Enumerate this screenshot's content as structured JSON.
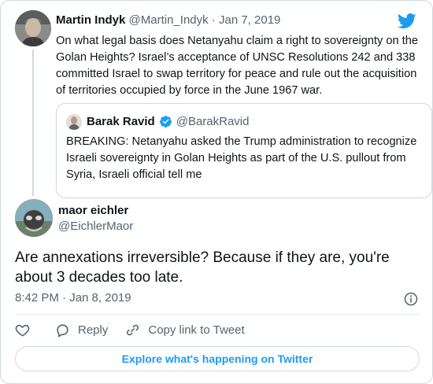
{
  "parent_tweet": {
    "author_name": "Martin Indyk",
    "handle": "@Martin_Indyk",
    "separator": "·",
    "date": "Jan 7, 2019",
    "text": "On what legal basis does Netanyahu claim a right to sovereignty on the Golan Heights? Israel’s acceptance of UNSC Resolutions 242 and 338 committed Israel to swap territory for peace and rule out the acquisition of territories occupied by force in the June 1967 war.",
    "quoted": {
      "author_name": "Barak Ravid",
      "handle": "@BarakRavid",
      "text": "BREAKING: Netanyahu asked the Trump administration to recognize Israeli sovereignty in Golan Heights as part of the U.S. pullout from Syria, Israeli official tell me"
    }
  },
  "main_tweet": {
    "author_name": "maor eichler",
    "handle": "@EichlerMaor",
    "text": "Are annexations irreversible? Because if they are, you're about 3 decades too late.",
    "timestamp": "8:42 PM · Jan 8, 2019"
  },
  "actions": {
    "reply_label": "Reply",
    "copy_link_label": "Copy link to Tweet"
  },
  "explore_label": "Explore what's happening on Twitter",
  "colors": {
    "accent": "#1d9bf0",
    "text": "#0f1419",
    "muted": "#536471",
    "border": "#cfd9de"
  },
  "icons": [
    "twitter-bird-icon",
    "verified-badge-icon",
    "info-icon",
    "heart-icon",
    "reply-icon",
    "link-icon"
  ]
}
